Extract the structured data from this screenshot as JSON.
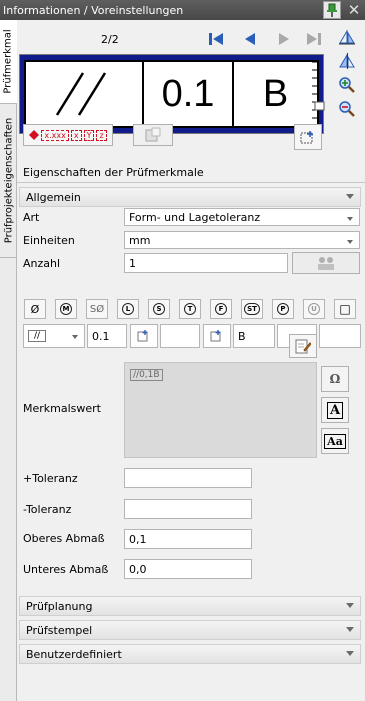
{
  "window": {
    "title": "Informationen / Voreinstellungen"
  },
  "tabs": [
    {
      "label": "Prüfmerkmal",
      "active": true
    },
    {
      "label": "Prüfprojekteigenschaften",
      "active": false
    }
  ],
  "navigator": {
    "page": "2/2"
  },
  "display": {
    "symbol": "//",
    "value": "0.1",
    "datum": "B"
  },
  "format_tags": [
    "x.xxx",
    "x",
    "Y",
    "z"
  ],
  "properties": {
    "header": "Eigenschaften der Prüfmerkmale",
    "general_section": "Allgemein",
    "art_label": "Art",
    "art_value": "Form- und Lagetoleranz",
    "einheiten_label": "Einheiten",
    "einheiten_value": "mm",
    "anzahl_label": "Anzahl",
    "anzahl_value": "1",
    "symbols": [
      "Ø",
      "M",
      "SØ",
      "L",
      "S",
      "T",
      "F",
      "ST",
      "P",
      "U",
      "□"
    ],
    "tol_value": "0.1",
    "datum_value": "B",
    "merkmalswert_label": "Merkmalswert",
    "merkmalswert_preview": "//0,1B",
    "side_buttons": [
      "Ω",
      "A",
      "Aa"
    ],
    "plus_tol_label": "+Toleranz",
    "minus_tol_label": "-Toleranz",
    "oberes_label": "Oberes Abmaß",
    "oberes_value": "0,1",
    "unteres_label": "Unteres Abmaß",
    "unteres_value": "0,0"
  },
  "sections": [
    "Prüfplanung",
    "Prüfstempel",
    "Benutzerdefiniert"
  ],
  "colors": {
    "display_frame": "#101c8c",
    "nav_blue": "#2a5db8",
    "tag_red": "#d01020"
  }
}
